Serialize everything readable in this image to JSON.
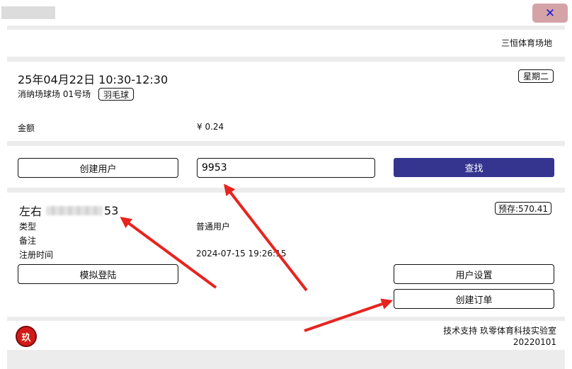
{
  "window": {
    "close_label": "✕"
  },
  "venue": {
    "name": "三恒体育场地"
  },
  "booking": {
    "datetime": "25年04月22日 10:30-12:30",
    "weekday": "星期二",
    "court": "消纳场球场 01号场",
    "sport": "羽毛球",
    "amount_label": "金额",
    "amount_value": "¥ 0.24"
  },
  "search": {
    "create_user_label": "创建用户",
    "query_value": "9953",
    "search_label": "查找"
  },
  "user": {
    "name_prefix": "左右",
    "name_suffix": "53",
    "balance": "预存:570.41",
    "type_label": "类型",
    "type_value": "普通用户",
    "note_label": "备注",
    "note_value": "",
    "register_label": "注册时间",
    "register_value": "2024-07-15 19:26:15",
    "simulate_login_label": "模拟登陆",
    "user_settings_label": "用户设置",
    "create_order_label": "创建订单"
  },
  "footer": {
    "logo_char": "玖",
    "support": "技术支持 玖零体育科技实验室",
    "version": "20220101"
  },
  "colors": {
    "primary": "#35348f",
    "close_bg": "#d3a3a8",
    "annotation_arrow": "#e8231e"
  }
}
